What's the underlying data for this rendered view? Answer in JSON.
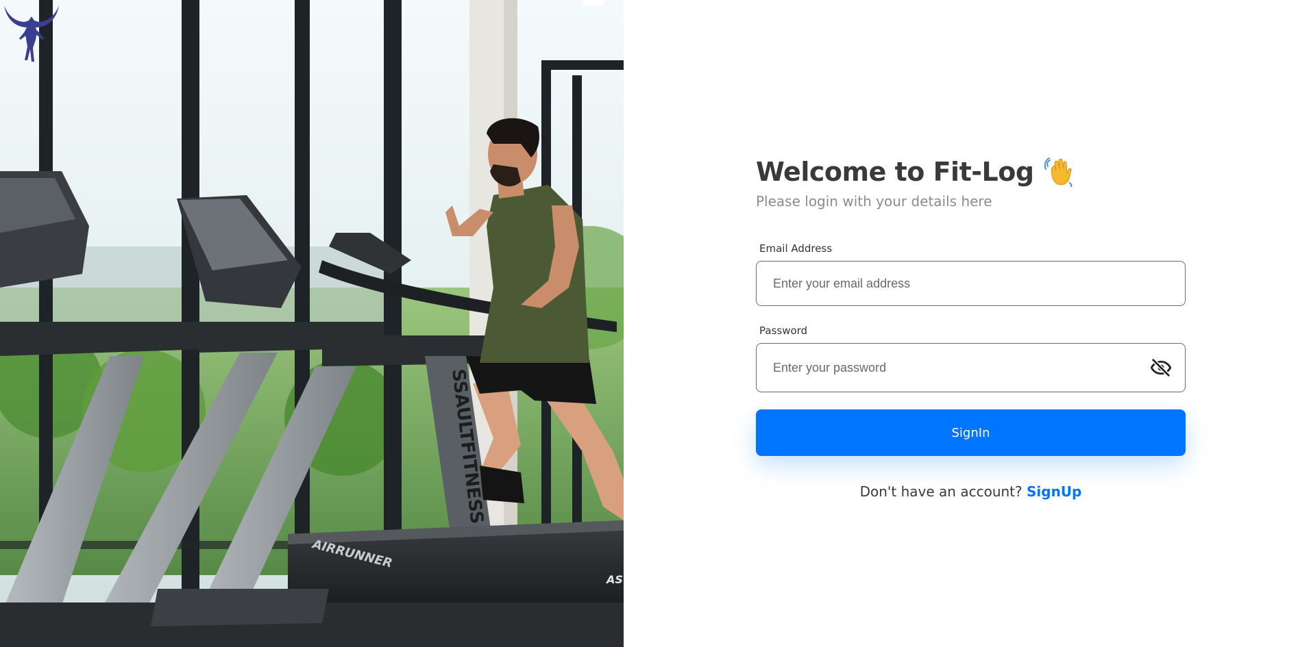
{
  "hero": {
    "treadmill_brand_text": "SSAULTFITNESS",
    "treadmill_model_text": "AIRRUNNER",
    "treadmill_logo_text": "AS FIT"
  },
  "form": {
    "title": "Welcome to Fit-Log",
    "subtitle": "Please login with your details here",
    "email": {
      "label": "Email Address",
      "placeholder": "Enter your email address",
      "value": ""
    },
    "password": {
      "label": "Password",
      "placeholder": "Enter your password",
      "value": "",
      "toggle_icon": "eye-off-icon"
    },
    "signin_label": "SignIn",
    "signup_prompt": "Don't have an account?",
    "signup_link": "SignUp"
  },
  "colors": {
    "accent": "#0075ff",
    "title": "#3a3a3a",
    "subtitle": "#8c8c8c",
    "logo": "#3b3f8f"
  },
  "icons": {
    "logo": "bull-athlete-logo-icon",
    "wave": "waving-hand-icon"
  }
}
